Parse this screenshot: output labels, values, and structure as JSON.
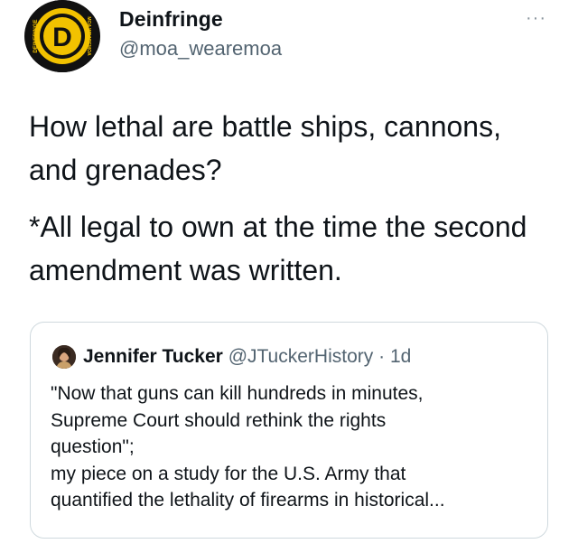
{
  "author": {
    "display_name": "Deinfringe",
    "handle": "@moa_wearemoa",
    "avatar_letter": "D",
    "avatar_text_left": "DEINFRINGE",
    "avatar_text_right": "MOA WEAREMOA",
    "avatar_colors": {
      "outer": "#111111",
      "ring": "#f2c200",
      "inner": "#111111"
    }
  },
  "more_glyph": "···",
  "tweet": {
    "line1": "How lethal are battle ships, cannons,",
    "line2": "and grenades?",
    "line3": "*All legal to own at the time the second",
    "line4": "amendment was written."
  },
  "quote": {
    "author_name": "Jennifer Tucker",
    "author_handle": "@JTuckerHistory",
    "separator": "·",
    "time": "1d",
    "lines": [
      "\"Now that guns can kill hundreds in minutes,",
      "Supreme Court should rethink the rights",
      "question\";",
      "my piece on a study for the U.S. Army that",
      "quantified the lethality of firearms in historical..."
    ]
  },
  "colors": {
    "text": "#0f1419",
    "secondary": "#536471",
    "border": "#cfd9de"
  }
}
